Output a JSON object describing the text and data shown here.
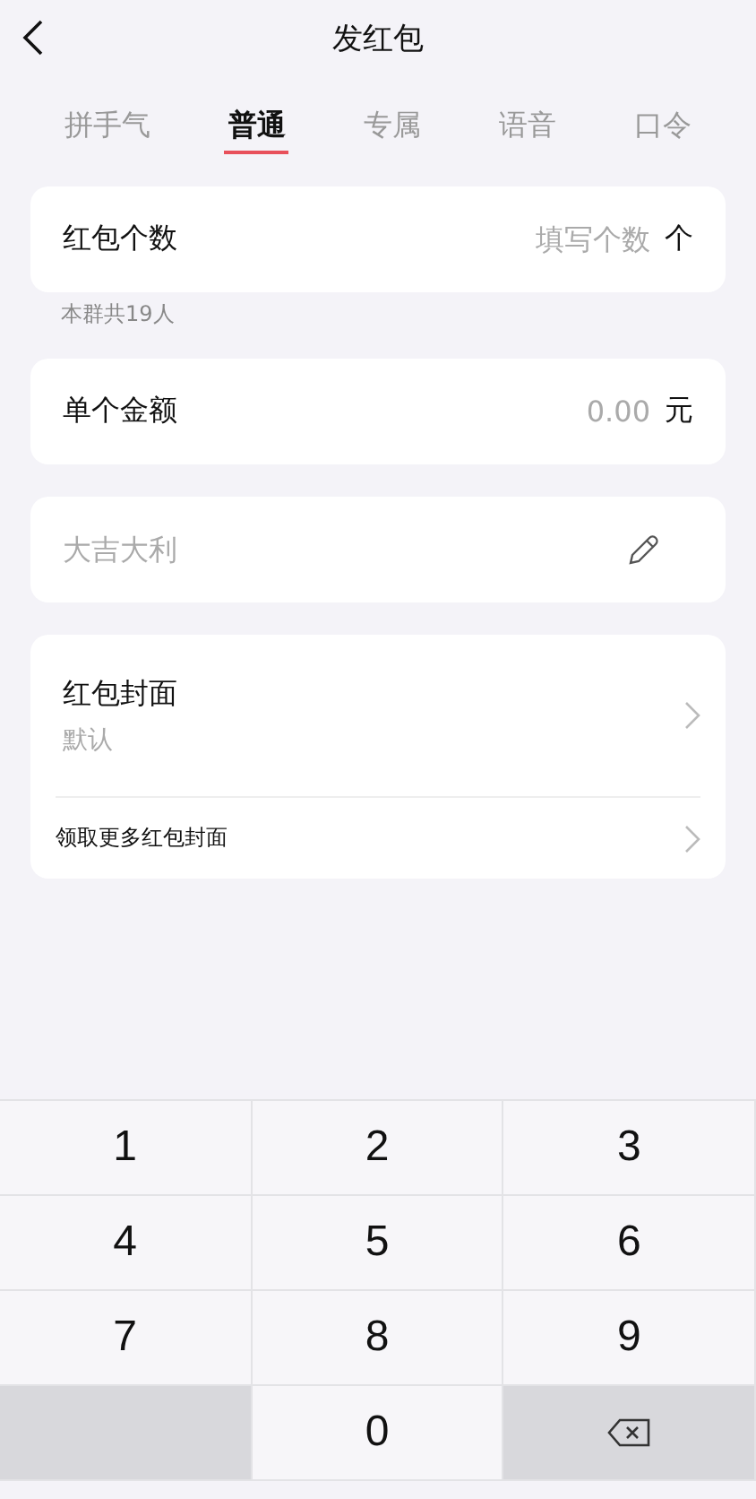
{
  "nav": {
    "title": "发红包"
  },
  "tabs": [
    {
      "label": "拼手气",
      "selected": false
    },
    {
      "label": "普通",
      "selected": true
    },
    {
      "label": "专属",
      "selected": false
    },
    {
      "label": "语音",
      "selected": false
    },
    {
      "label": "口令",
      "selected": false
    }
  ],
  "count": {
    "label": "红包个数",
    "placeholder": "填写个数",
    "unit": "个",
    "note": "本群共19人"
  },
  "amount": {
    "label": "单个金额",
    "placeholder": "0.00",
    "unit": "元"
  },
  "greeting": {
    "placeholder": "大吉大利"
  },
  "cover": {
    "label": "红包封面",
    "value": "默认",
    "more": "领取更多红包封面"
  },
  "keypad": [
    {
      "kind": "digit",
      "label": "1"
    },
    {
      "kind": "digit",
      "label": "2"
    },
    {
      "kind": "digit",
      "label": "3"
    },
    {
      "kind": "digit",
      "label": "4"
    },
    {
      "kind": "digit",
      "label": "5"
    },
    {
      "kind": "digit",
      "label": "6"
    },
    {
      "kind": "digit",
      "label": "7"
    },
    {
      "kind": "digit",
      "label": "8"
    },
    {
      "kind": "digit",
      "label": "9"
    },
    {
      "kind": "blank"
    },
    {
      "kind": "digit",
      "label": "0"
    },
    {
      "kind": "delete"
    }
  ]
}
